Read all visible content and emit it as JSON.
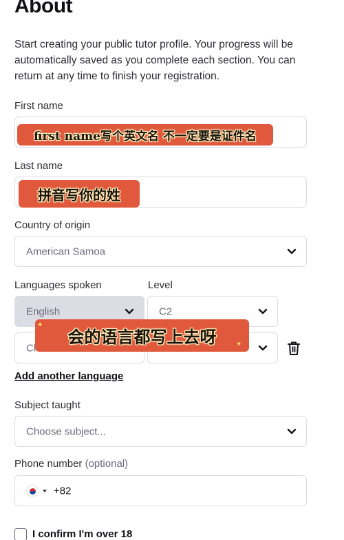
{
  "page": {
    "title": "About",
    "intro": "Start creating your public tutor profile. Your progress will be automatically saved as you complete each section. You can return at any time to finish your registration."
  },
  "first_name": {
    "label": "First name",
    "sticker": "first name写个英文名 不一定要是证件名"
  },
  "last_name": {
    "label": "Last name",
    "sticker": "拼音写你的姓"
  },
  "country": {
    "label": "Country of origin",
    "value": "American Samoa"
  },
  "languages": {
    "label": "Languages spoken",
    "level_label": "Level",
    "row1_language": "English",
    "row1_level": "C2",
    "row2_language": "Cl",
    "sticker": "会的语言都写上去呀",
    "add_link": "Add another language"
  },
  "subject": {
    "label": "Subject taught",
    "placeholder": "Choose subject..."
  },
  "phone": {
    "label": "Phone number",
    "optional": "(optional)",
    "code": "+82"
  },
  "confirm": {
    "label": "I confirm I'm over 18"
  },
  "colors": {
    "sticker_bg": "#e0593c",
    "border": "#dcdce5",
    "muted_text": "#6a697c"
  },
  "icons": {
    "chevron": "chevron-down-icon",
    "trash": "trash-icon",
    "flag": "south-korea-flag-icon"
  }
}
